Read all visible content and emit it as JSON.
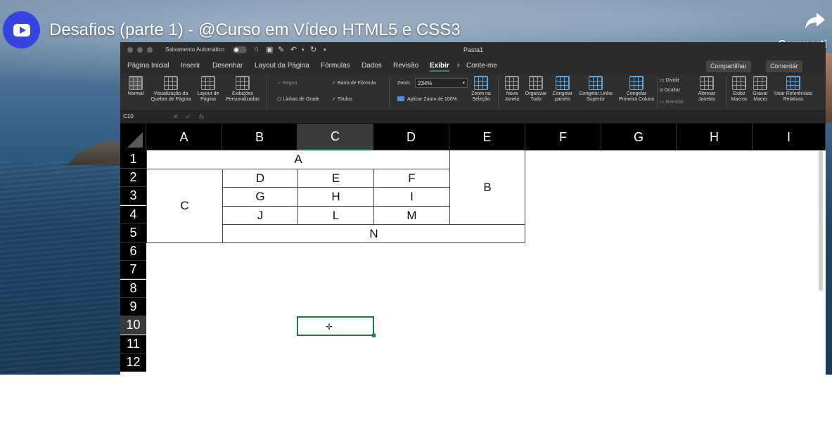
{
  "video": {
    "title": "Desafios (parte 1) - @Curso em Vídeo HTML5 e CSS3",
    "share_label": "Comparti"
  },
  "excel": {
    "autosave_label": "Salvamento Automático",
    "window_title": "Pasta1",
    "menu_tabs": [
      "Página Inicial",
      "Inserir",
      "Desenhar",
      "Layout da Página",
      "Fórmulas",
      "Dados",
      "Revisão",
      "Exibir",
      "Conte-me"
    ],
    "active_tab": "Exibir",
    "share_button": "Compartilhar",
    "comments_button": "Comentár",
    "ribbon": {
      "normal": "Normal",
      "page_break": "Visualização da Quebra de Página",
      "page_layout": "Layout de Página",
      "custom_views": "Exibições Personalizadas",
      "ruler": "Régua",
      "gridlines": "Linhas de Grade",
      "formula_bar": "Barra de Fórmula",
      "headings": "Títulos",
      "zoom_label": "Zoom",
      "zoom_value": "234%",
      "zoom_100": "Aplicar Zoom de 100%",
      "zoom_selection": "Zoom na Seleção",
      "new_window": "Nova Janela",
      "arrange_all": "Organizar Tudo",
      "freeze_panes": "Congelar painéis",
      "freeze_top_row": "Congelar Linha Superior",
      "freeze_first_col": "Congelar Primeira Coluna",
      "split": "Dividir",
      "hide": "Ocultar",
      "unhide": "Reexibir",
      "switch_windows": "Alternar Janelas",
      "view_macros": "Exibir Macros",
      "record_macro": "Gravar Macro",
      "relative_refs": "Usar Referências Relativas"
    },
    "name_box": "C10",
    "fx_label": "fx",
    "columns": [
      "A",
      "B",
      "C",
      "D",
      "E",
      "F",
      "G",
      "H",
      "I"
    ],
    "rows": [
      "1",
      "2",
      "3",
      "4",
      "5",
      "6",
      "7",
      "8",
      "9",
      "10",
      "11",
      "12"
    ],
    "cells": {
      "A": "A",
      "B": "B",
      "C": "C",
      "D": "D",
      "E": "E",
      "F": "F",
      "G": "G",
      "H": "H",
      "I": "I",
      "J": "J",
      "L": "L",
      "M": "M",
      "N": "N"
    }
  }
}
